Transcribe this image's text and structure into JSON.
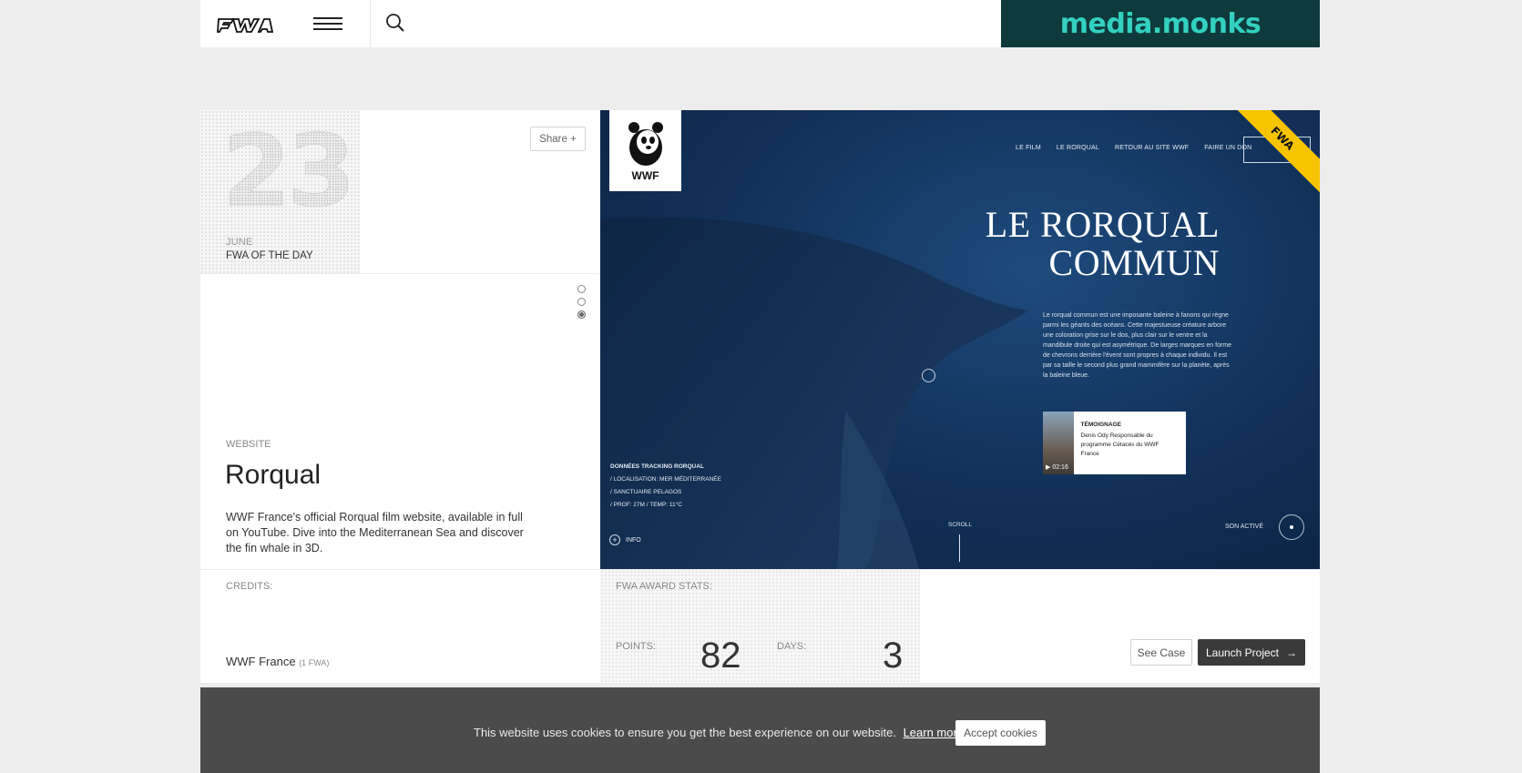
{
  "header": {
    "logo_label": "FWA",
    "ad_text": "media.monks"
  },
  "day_card": {
    "day_number": "23",
    "month": "JUNE",
    "label": "FWA OF THE DAY",
    "share_label": "Share +",
    "slides": 3,
    "active_slide": 3
  },
  "project": {
    "category": "WEBSITE",
    "title": "Rorqual",
    "description": "WWF France's official Rorqual film website, available in full on YouTube. Dive into the Mediterranean Sea and discover the fin whale in 3D."
  },
  "hero": {
    "logo_text": "WWF",
    "nav": [
      "LE FILM",
      "LE RORQUAL",
      "RETOUR AU SITE WWF",
      "FAIRE UN DON"
    ],
    "ribbon": "FWA",
    "title_line1": "LE RORQUAL",
    "title_line2": "COMMUN",
    "paragraph": "Le rorqual commun est une imposante baleine à fanons qui règne parmi les géants des océans. Cette majestueuse créature arbore une coloration grise sur le dos, plus clair sur le ventre et la mandibule droite qui est asymétrique. De larges marques en forme de chevrons derrière l'évent sont propres à chaque individu. Il est par sa taille le second plus grand mammifère sur la planète, après la baleine bleue.",
    "testimony_title": "TÉMOIGNAGE",
    "testimony_text": "Denis Ody Responsable du programme Cétacés du WWF France",
    "testimony_time": "▶ 02:16",
    "tracking_title": "DONNÉES TRACKING RORQUAL",
    "tracking_lines": [
      "/ LOCALISATION: MER MÉDITERRANÉE",
      "/ SANCTUAIRE PELAGOS",
      "/ PROF: 27M / TEMP: 11°C"
    ],
    "info_label": "INFO",
    "scroll_label": "SCROLL",
    "sound_label": "SON ACTIVÉ"
  },
  "credits": {
    "label": "CREDITS:",
    "name": "WWF France",
    "count": "(1 FWA)"
  },
  "stats": {
    "label": "FWA AWARD STATS:",
    "points_label": "POINTS:",
    "points": "82",
    "days_label": "DAYS:",
    "days": "3"
  },
  "actions": {
    "see_case": "See Case",
    "launch": "Launch Project"
  },
  "cookie": {
    "text": "This website uses cookies to ensure you get the best experience on our website.",
    "link": "Learn more",
    "button": "Accept cookies"
  },
  "colors": {
    "ad_bg": "#0f3a3c",
    "ad_text": "#33d1bf",
    "ribbon": "#f6c400",
    "hero_bg": "#13335d",
    "cookie_bg": "#4b4b4b"
  }
}
